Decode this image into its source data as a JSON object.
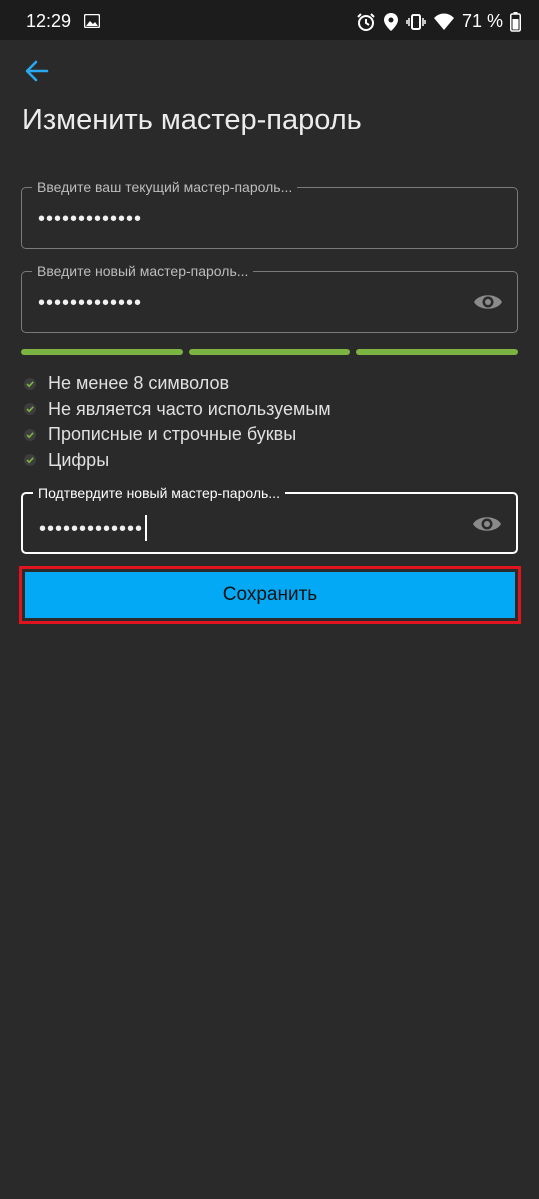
{
  "status_bar": {
    "time": "12:29",
    "battery": "71 %",
    "icons": [
      "gallery-icon",
      "alarm-icon",
      "location-icon",
      "vibrate-icon",
      "wifi-icon",
      "battery-icon"
    ]
  },
  "header": {
    "back_icon": "arrow-left-icon",
    "title": "Изменить мастер-пароль"
  },
  "fields": {
    "current": {
      "label": "Введите ваш текущий мастер-пароль...",
      "value": "•••••••••••••"
    },
    "new": {
      "label": "Введите новый мастер-пароль...",
      "value": "•••••••••••••"
    },
    "confirm": {
      "label": "Подтвердите новый мастер-пароль...",
      "value": "•••••••••••••"
    }
  },
  "strength_meter": {
    "segments_filled": 3,
    "segments_total": 3,
    "color": "#7cb342"
  },
  "requirements": [
    {
      "label": "Не менее 8 символов",
      "met": true
    },
    {
      "label": "Не является часто используемым",
      "met": true
    },
    {
      "label": "Прописные и строчные буквы",
      "met": true
    },
    {
      "label": "Цифры",
      "met": true
    }
  ],
  "save_button": {
    "label": "Сохранить",
    "color": "#03a9f4"
  },
  "colors": {
    "accent": "#03a9f4",
    "highlight_border": "#e0141e",
    "background": "#2a2a2a"
  }
}
